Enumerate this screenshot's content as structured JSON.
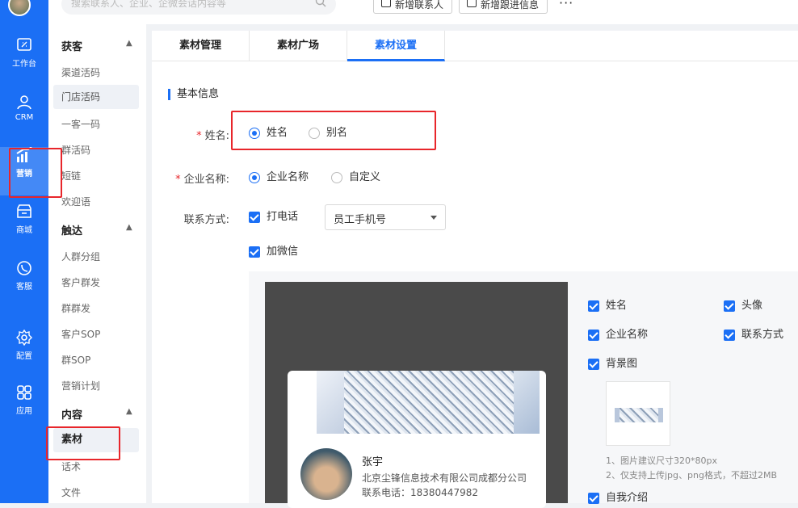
{
  "rail": {
    "items": [
      {
        "label": "工作台",
        "icon": "workbench-icon"
      },
      {
        "label": "CRM",
        "icon": "user-icon"
      },
      {
        "label": "营销",
        "icon": "chart-up-icon"
      },
      {
        "label": "商城",
        "icon": "store-icon"
      },
      {
        "label": "客服",
        "icon": "phone-chat-icon"
      },
      {
        "label": "配置",
        "icon": "gear-icon"
      },
      {
        "label": "应用",
        "icon": "apps-grid-icon"
      }
    ],
    "active_index": 2,
    "accent": "#1b6ff5"
  },
  "sidebar": {
    "groups": [
      {
        "title": "获客",
        "items": [
          "渠道活码",
          "门店活码",
          "一客一码",
          "群活码",
          "短链",
          "欢迎语"
        ]
      },
      {
        "title": "触达",
        "items": [
          "人群分组",
          "客户群发",
          "群群发",
          "客户SOP",
          "群SOP",
          "营销计划"
        ]
      },
      {
        "title": "内容",
        "items": [
          "素材",
          "话术",
          "文件"
        ]
      }
    ],
    "selected_item": "门店活码",
    "current_item": "素材"
  },
  "topbar": {
    "search_placeholder": "搜索联系人、企业、企微会话内容等",
    "buttons": [
      "新增联系人",
      "新增跟进信息"
    ],
    "more": "···"
  },
  "tabs": [
    "素材管理",
    "素材广场",
    "素材设置"
  ],
  "active_tab": 2,
  "form": {
    "section_title": "基本信息",
    "name": {
      "label": "姓名:",
      "options": [
        "姓名",
        "别名"
      ],
      "selected": 0
    },
    "company": {
      "label": "企业名称:",
      "options": [
        "企业名称",
        "自定义"
      ],
      "selected": 0
    },
    "contact": {
      "label": "联系方式:",
      "call_label": "打电话",
      "call_checked": true,
      "call_select": "员工手机号",
      "wechat_label": "加微信",
      "wechat_checked": true
    }
  },
  "preview_card": {
    "name": "张宇",
    "company": "北京尘锋信息技术有限公司成都分公司",
    "phone": "联系电话：18380447982"
  },
  "card_fields": {
    "col1": [
      "姓名",
      "企业名称",
      "背景图"
    ],
    "col2": [
      "头像",
      "联系方式"
    ],
    "last": "自我介绍",
    "hints": [
      "1、图片建议尺寸320*80px",
      "2、仅支持上传jpg、png格式，不超过2MB"
    ]
  }
}
